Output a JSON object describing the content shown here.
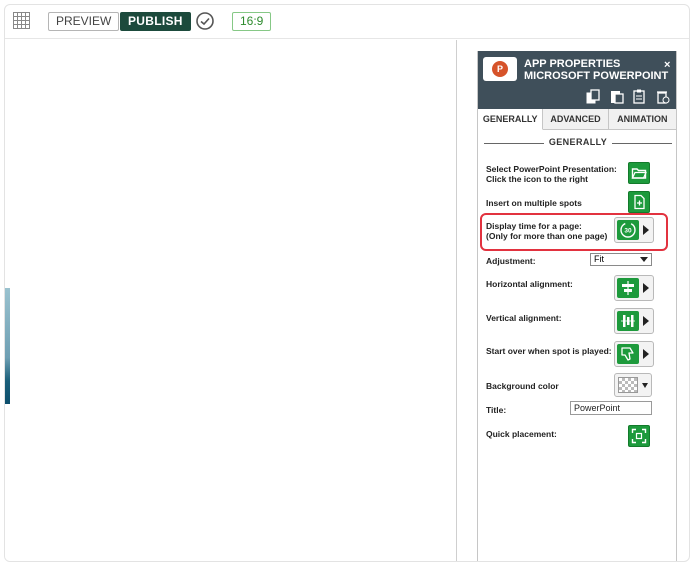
{
  "toolbar": {
    "preview_label": "PREVIEW",
    "publish_label": "PUBLISH",
    "ratio_label": "16:9"
  },
  "panel": {
    "title_line1": "APP PROPERTIES",
    "title_line2": "MICROSOFT POWERPOINT",
    "logo_letter": "P",
    "close_label": "×",
    "tabs": [
      {
        "label": "GENERALLY",
        "active": true
      },
      {
        "label": "ADVANCED",
        "active": false
      },
      {
        "label": "ANIMATION",
        "active": false
      }
    ],
    "section_title": "GENERALLY",
    "select_presentation_line1": "Select PowerPoint Presentation:",
    "select_presentation_line2": "Click the icon to the right",
    "insert_multiple": "Insert on multiple spots",
    "display_time_line1": "Display time for a page:",
    "display_time_line2": "(Only for more than one page)",
    "display_time_value": "30",
    "adjustment_label": "Adjustment:",
    "adjustment_value": "Fit",
    "horizontal_alignment": "Horizontal alignment:",
    "vertical_alignment": "Vertical alignment:",
    "start_over": "Start over when spot is played:",
    "background_color": "Background color",
    "title_label": "Title:",
    "title_value": "PowerPoint",
    "quick_placement": "Quick placement:"
  },
  "colors": {
    "accent_green": "#1d9a3c",
    "publish_bg": "#1c4a3c",
    "panel_header": "#3f4f5a",
    "highlight": "#e2323f"
  },
  "icons": [
    "grid-icon",
    "check-circle-icon",
    "powerpoint-logo-icon",
    "close-icon",
    "copy-icon",
    "paste-icon",
    "clipboard-icon",
    "delete-icon",
    "folder-icon",
    "multi-insert-icon",
    "timer-icon",
    "align-horizontal-icon",
    "align-vertical-icon",
    "thumbs-down-icon",
    "expand-icon"
  ]
}
